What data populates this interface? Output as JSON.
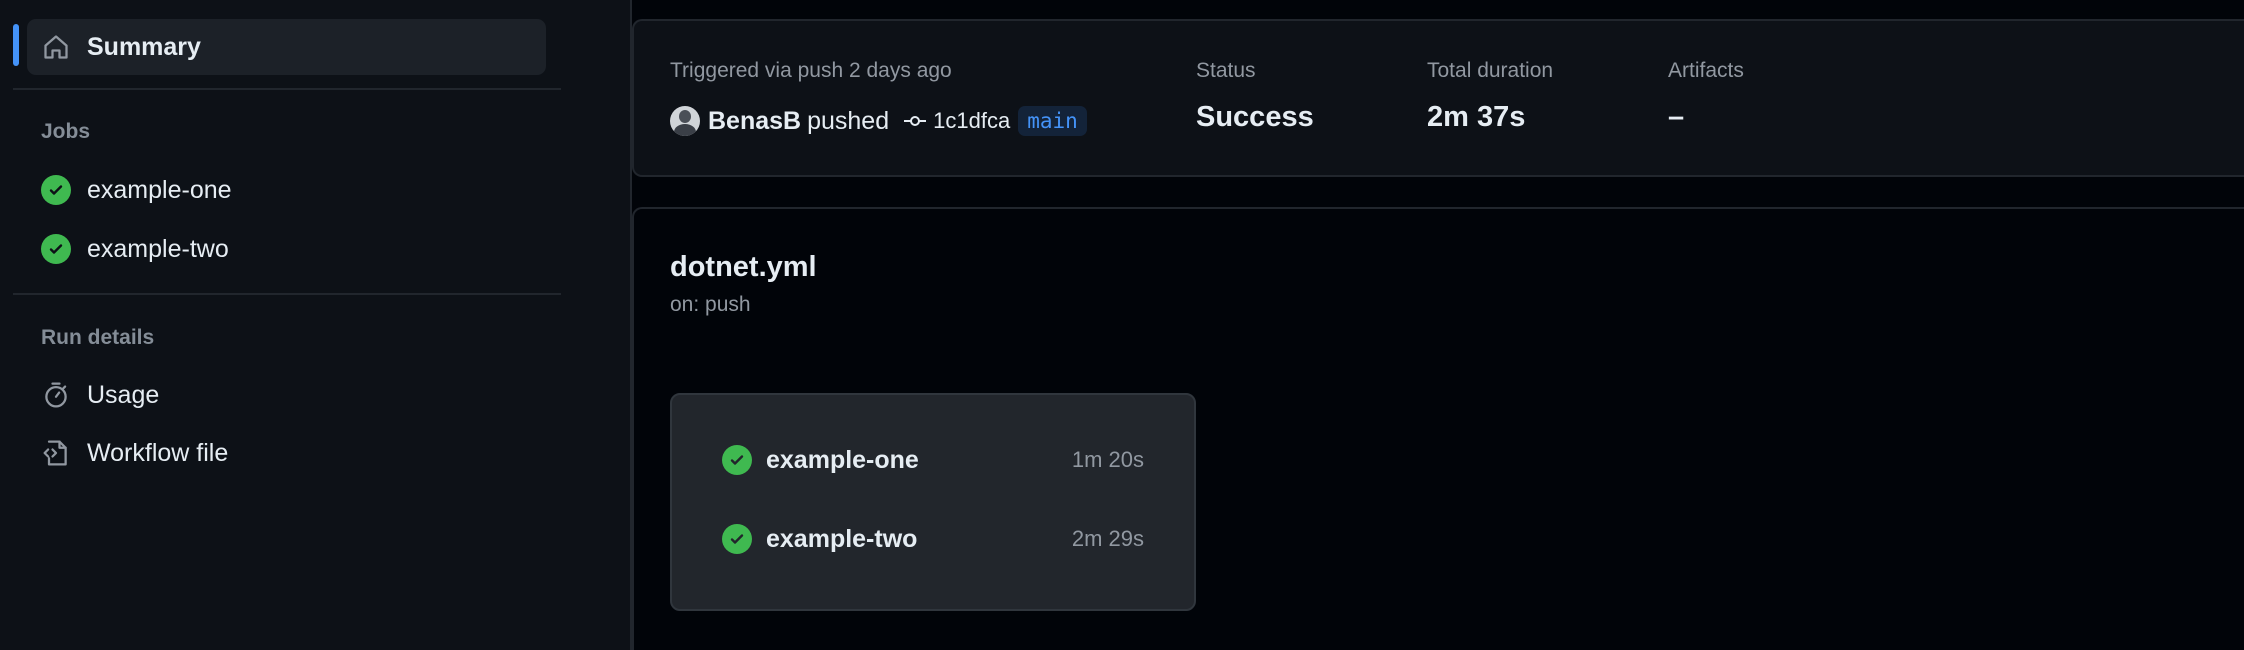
{
  "sidebar": {
    "summary_label": "Summary",
    "jobs_title": "Jobs",
    "jobs": [
      {
        "label": "example-one",
        "status": "success"
      },
      {
        "label": "example-two",
        "status": "success"
      }
    ],
    "run_details_title": "Run details",
    "usage_label": "Usage",
    "workflow_file_label": "Workflow file"
  },
  "summary": {
    "trigger_text": "Triggered via push 2 days ago",
    "actor": "BenasB",
    "action": "pushed",
    "commit_sha": "1c1dfca",
    "branch": "main",
    "status_label": "Status",
    "status_value": "Success",
    "duration_label": "Total duration",
    "duration_value": "2m 37s",
    "artifacts_label": "Artifacts",
    "artifacts_value": "–"
  },
  "workflow": {
    "file_name": "dotnet.yml",
    "trigger": "on: push",
    "jobs": [
      {
        "name": "example-one",
        "duration": "1m 20s",
        "status": "success"
      },
      {
        "name": "example-two",
        "duration": "2m 29s",
        "status": "success"
      }
    ]
  },
  "colors": {
    "accent": "#4493f8",
    "success": "#3fb950",
    "background": "#010409",
    "sidebar_bg": "#0d1117"
  },
  "icons": {
    "summary": "home-icon",
    "job_status": "check-circle-icon",
    "usage": "stopwatch-icon",
    "workflow_file": "file-code-icon",
    "commit": "git-commit-icon"
  }
}
